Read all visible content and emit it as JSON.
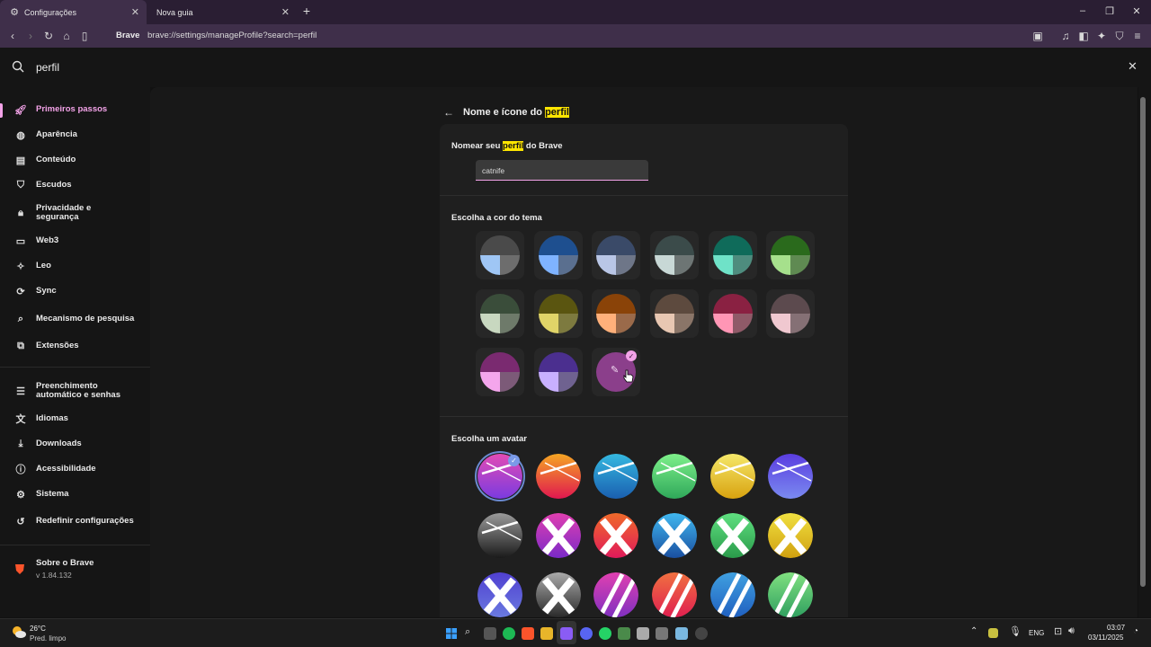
{
  "browser": {
    "tabs": [
      {
        "label": "Configurações",
        "active": true
      },
      {
        "label": "Nova guia",
        "active": false
      }
    ],
    "site_label": "Brave",
    "url": "brave://settings/manageProfile?search=perfil"
  },
  "search": {
    "query": "perfil"
  },
  "sidebar": {
    "items": [
      {
        "label": "Primeiros passos",
        "icon": "rocket-icon"
      },
      {
        "label": "Aparência",
        "icon": "palette-icon"
      },
      {
        "label": "Conteúdo",
        "icon": "content-icon"
      },
      {
        "label": "Escudos",
        "icon": "shield-icon"
      },
      {
        "label": "Privacidade e segurança",
        "icon": "lock-icon"
      },
      {
        "label": "Web3",
        "icon": "wallet-icon"
      },
      {
        "label": "Leo",
        "icon": "leo-icon"
      },
      {
        "label": "Sync",
        "icon": "sync-icon"
      },
      {
        "label": "Mecanismo de pesquisa",
        "icon": "search-icon"
      },
      {
        "label": "Extensões",
        "icon": "puzzle-icon"
      },
      {
        "label": "Preenchimento automático e senhas",
        "icon": "list-icon"
      },
      {
        "label": "Idiomas",
        "icon": "translate-icon"
      },
      {
        "label": "Downloads",
        "icon": "download-icon"
      },
      {
        "label": "Acessibilidade",
        "icon": "accessibility-icon"
      },
      {
        "label": "Sistema",
        "icon": "gear-icon"
      },
      {
        "label": "Redefinir configurações",
        "icon": "reset-icon"
      }
    ],
    "about": {
      "label": "Sobre o Brave",
      "version": "v 1.84.132"
    }
  },
  "profile": {
    "heading_prefix": "Nome e ícone do ",
    "heading_highlight": "perfil",
    "name_label_prefix": "Nomear seu ",
    "name_label_highlight": "perfil",
    "name_label_suffix": " do Brave",
    "name_value": "catnife",
    "theme_label": "Escolha a cor do tema",
    "avatar_label": "Escolha um avatar",
    "theme_colors": [
      {
        "top": "#4a4a4a",
        "left": "#9fc6f5",
        "right": "#6d6d6d"
      },
      {
        "top": "#1e4f8f",
        "left": "#7fb3ff",
        "right": "#5a6f8f"
      },
      {
        "top": "#3a4a68",
        "left": "#b9c6e6",
        "right": "#6e7688"
      },
      {
        "top": "#3b4b4a",
        "left": "#c8d8d6",
        "right": "#6d7574"
      },
      {
        "top": "#0f6b5a",
        "left": "#6fe2c8",
        "right": "#4e8c7e"
      },
      {
        "top": "#2a6a1c",
        "left": "#a6e08c",
        "right": "#5f8a52"
      },
      {
        "top": "#3a4d3a",
        "left": "#c8d8c0",
        "right": "#6e7a6a"
      },
      {
        "top": "#5a5510",
        "left": "#e0d468",
        "right": "#7d7a3f"
      },
      {
        "top": "#8a4308",
        "left": "#ffb07a",
        "right": "#9a6a4a"
      },
      {
        "top": "#5d4a3e",
        "left": "#e8c7b2",
        "right": "#8a7568"
      },
      {
        "top": "#8a2142",
        "left": "#ff96b5",
        "right": "#8f5a68"
      },
      {
        "top": "#5c4a4e",
        "left": "#f0c8d0",
        "right": "#857075"
      },
      {
        "top": "#7a2a70",
        "left": "#f4a6ec",
        "right": "#7c5a78"
      },
      {
        "top": "#4b2f8f",
        "left": "#c8b0ff",
        "right": "#6f6290"
      }
    ],
    "custom_color": "#8b3f8b",
    "selected_badge_color": "#f3a3e8",
    "avatars": [
      [
        "#e24bb5",
        "#7a3be0"
      ],
      [
        "#f5a623",
        "#e0174f"
      ],
      [
        "#35b8e0",
        "#1a5fb0"
      ],
      [
        "#7ef08a",
        "#2fa85a"
      ],
      [
        "#f5e86a",
        "#d8a20f"
      ],
      [
        "#5a3de0",
        "#7a8af0"
      ],
      [
        "#9a9a9a",
        "#1a1a1a"
      ],
      [
        "#e03fb0",
        "#7a2ac8"
      ],
      [
        "#f06a2a",
        "#e01a5a"
      ],
      [
        "#40b8f0",
        "#1a4fa0"
      ],
      [
        "#5fe080",
        "#2a9a4a"
      ],
      [
        "#f0e040",
        "#d0a010"
      ],
      [
        "#5040d0",
        "#6a7ae0"
      ],
      [
        "#aaaaaa",
        "#2a2a2a"
      ],
      [
        "#e040b0",
        "#8030c0"
      ],
      [
        "#f07040",
        "#e02050"
      ],
      [
        "#40a0e0",
        "#2060c0"
      ],
      [
        "#80e080",
        "#30a060"
      ]
    ]
  },
  "taskbar": {
    "weather_temp": "26°C",
    "weather_desc": "Pred. limpo",
    "lang": "ENG",
    "time": "03:07",
    "date": "03/11/2025"
  }
}
